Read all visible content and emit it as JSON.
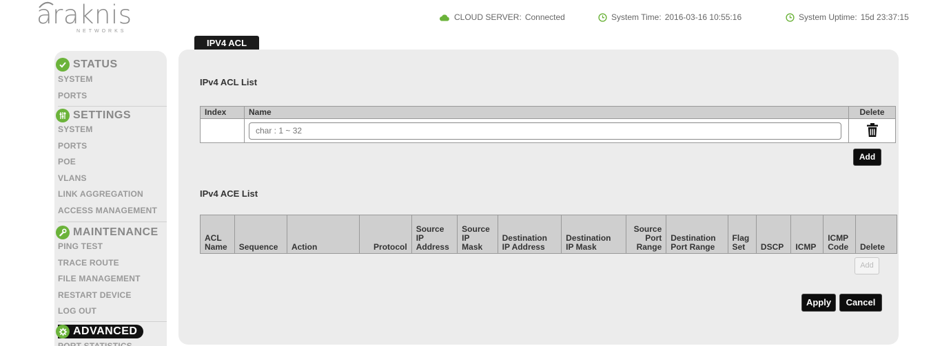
{
  "brand": {
    "name": "araknis",
    "sub": "NETWORKS"
  },
  "top": {
    "cloud_label": "CLOUD SERVER:",
    "cloud_value": "Connected",
    "time_label": "System Time:",
    "time_value": "2016-03-16 10:55:16",
    "uptime_label": "System Uptime:",
    "uptime_value": "15d 23:37:15"
  },
  "page_tab": "IPV4 ACL",
  "sidebar": {
    "status": {
      "title": "STATUS",
      "items": [
        "SYSTEM",
        "PORTS"
      ]
    },
    "settings": {
      "title": "SETTINGS",
      "items": [
        "SYSTEM",
        "PORTS",
        "POE",
        "VLANS",
        "LINK AGGREGATION",
        "ACCESS MANAGEMENT"
      ]
    },
    "maintenance": {
      "title": "MAINTENANCE",
      "items": [
        "PING TEST",
        "TRACE ROUTE",
        "FILE MANAGEMENT",
        "RESTART DEVICE",
        "LOG OUT"
      ]
    },
    "advanced": {
      "title": "ADVANCED",
      "items": [
        "PORT STATISTICS"
      ]
    }
  },
  "acl_list": {
    "title": "IPv4 ACL List",
    "headers": [
      "Index",
      "Name",
      "Delete"
    ],
    "name_placeholder": "char : 1 ~ 32",
    "add_label": "Add"
  },
  "ace_list": {
    "title": "IPv4 ACE List",
    "headers": [
      [
        "ACL",
        "Name"
      ],
      [
        "Sequence"
      ],
      [
        "Action"
      ],
      [
        "Protocol"
      ],
      [
        "Source",
        "IP",
        "Address"
      ],
      [
        "Source",
        "IP",
        "Mask"
      ],
      [
        "Destination",
        "IP Address"
      ],
      [
        "Destination",
        "IP Mask"
      ],
      [
        "Source",
        "Port",
        "Range"
      ],
      [
        "Destination",
        "Port Range"
      ],
      [
        "Flag",
        "Set"
      ],
      [
        "DSCP"
      ],
      [
        "ICMP"
      ],
      [
        "ICMP",
        "Code"
      ],
      [
        "Delete"
      ]
    ],
    "add_label": "Add"
  },
  "buttons": {
    "apply": "Apply",
    "cancel": "Cancel"
  },
  "colors": {
    "accent_green": "#6bb33a",
    "header_grey": "#cfcfcf",
    "panel_grey": "#ececec"
  }
}
